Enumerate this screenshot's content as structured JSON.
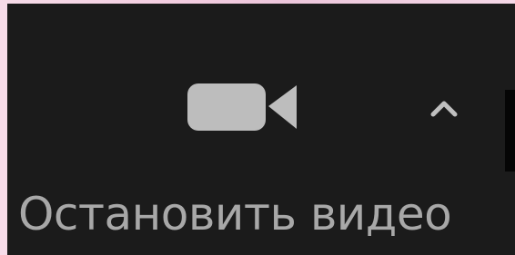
{
  "toolbar": {
    "video_button": {
      "label": "Остановить видео",
      "icon": "video-camera-icon",
      "icon_color": "#bdbdbd",
      "label_color": "#a8a8a8"
    },
    "options_icon": "chevron-up-icon",
    "background_color": "#1b1b1b"
  },
  "colors": {
    "outer_background": "#f3cde0",
    "toolbar": "#1b1b1b",
    "caret": "#c0c0c0"
  }
}
